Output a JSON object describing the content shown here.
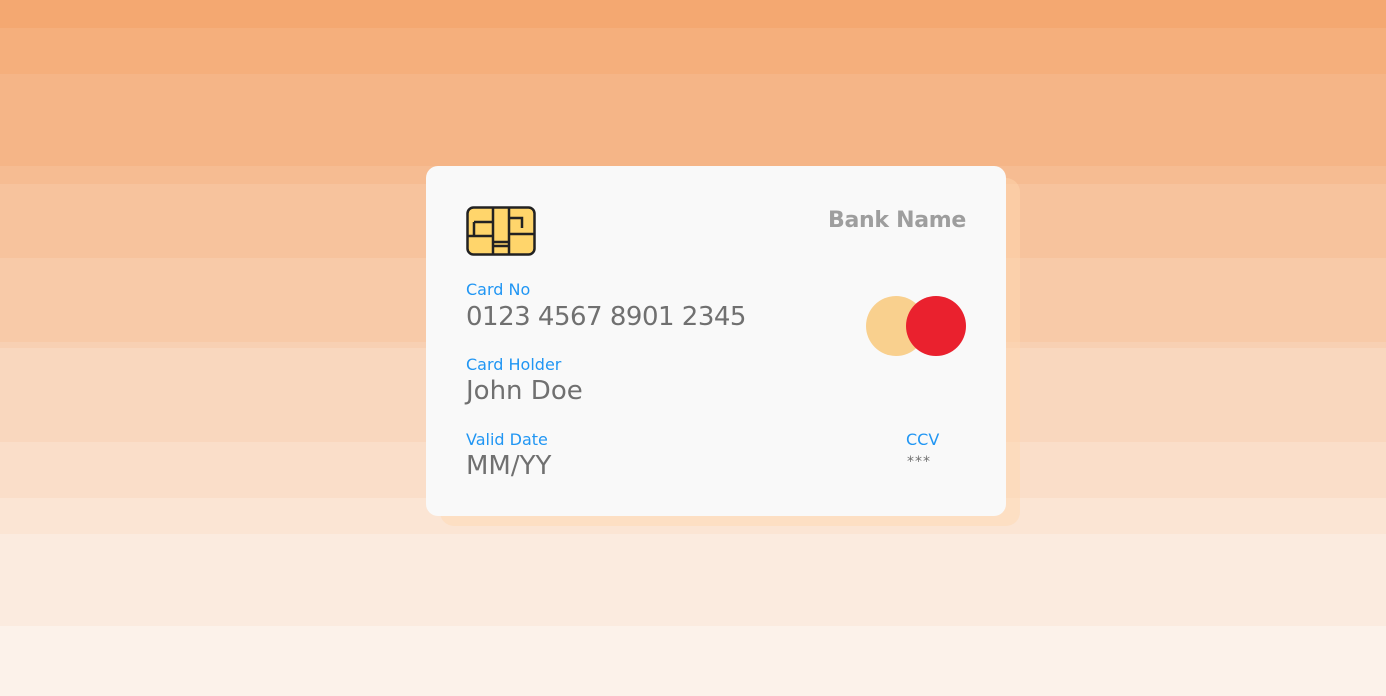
{
  "colors": {
    "background_top": "#f4a871",
    "background_bottom": "#fcf2ea",
    "card_background": "#f9f9f9",
    "label_color": "#2196f3",
    "value_color": "#707070",
    "bank_name_color": "#9e9e9e",
    "chip_fill": "#ffd56b",
    "logo_left_circle": "#f9d08e",
    "logo_right_circle": "#ea212e"
  },
  "card": {
    "bank_name": "Bank Name",
    "chip_icon": "sim-chip-icon",
    "logo_icon": "mastercard-logo-icon",
    "card_number": {
      "label": "Card No",
      "value": "0123 4567 8901 2345"
    },
    "card_holder": {
      "label": "Card Holder",
      "value": "John Doe"
    },
    "valid_date": {
      "label": "Valid Date",
      "value": "MM/YY"
    },
    "ccv": {
      "label": "CCV",
      "value": "***"
    }
  }
}
